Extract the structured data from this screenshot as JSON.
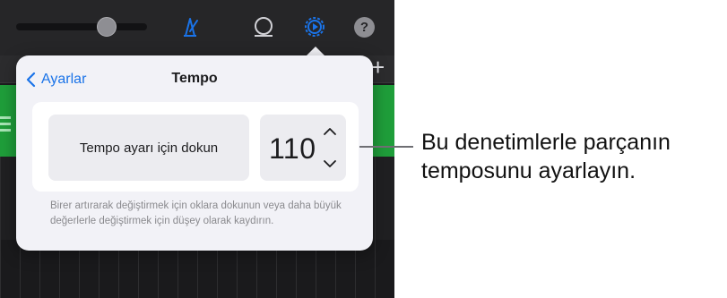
{
  "toolbar": {
    "icons": [
      "volume-slider",
      "metronome-icon",
      "loop-icon",
      "settings-gear-icon",
      "help-icon"
    ],
    "help_label": "?",
    "add_label": "+"
  },
  "colors": {
    "accent": "#1a73e8",
    "track_green": "#1f9e3a",
    "app_dark": "#1c1c1e"
  },
  "popover": {
    "back_label": "Ayarlar",
    "title": "Tempo",
    "tap_button_label": "Tempo ayarı için dokun",
    "tempo_value": "110",
    "hint": "Birer artırarak değiştirmek için oklara dokunun veya daha büyük değerlerle değiştirmek için düşey olarak kaydırın."
  },
  "callout": {
    "line1": "Bu denetimlerle parçanın",
    "line2": "temposunu ayarlayın."
  }
}
